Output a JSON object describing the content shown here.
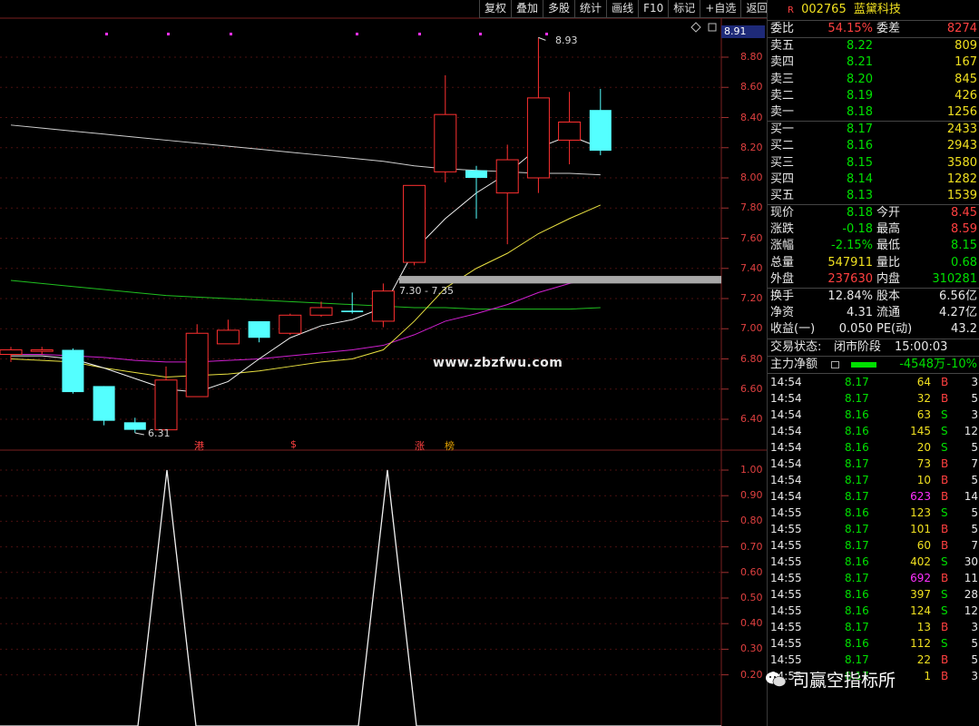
{
  "toolbar": [
    "复权",
    "叠加",
    "多股",
    "统计",
    "画线",
    "F10",
    "标记",
    "+自选",
    "返回"
  ],
  "price_tag": "8.91",
  "price_axis": [
    "8.80",
    "8.60",
    "8.40",
    "8.20",
    "8.00",
    "7.80",
    "7.60",
    "7.40",
    "7.20",
    "7.00",
    "6.80",
    "6.60",
    "6.40"
  ],
  "sub_axis": [
    "1.00",
    "0.90",
    "0.80",
    "0.70",
    "0.60",
    "0.50",
    "0.40",
    "0.30",
    "0.20"
  ],
  "annotations": {
    "high": "8.93",
    "low": "6.31",
    "range": "7.30 - 7.35"
  },
  "markers": [
    {
      "text": "港",
      "color": "#ff4040"
    },
    {
      "text": "$",
      "color": "#ff4040"
    },
    {
      "text": "涨",
      "color": "#ff4040"
    },
    {
      "text": "榜",
      "color": "#e0a000"
    }
  ],
  "watermark": "www.zbzfwu.com",
  "chart_data": {
    "type": "candlestick",
    "candles": [
      {
        "o": 6.86,
        "c": 6.83,
        "h": 6.88,
        "l": 6.78,
        "color": "red"
      },
      {
        "o": 6.86,
        "c": 6.85,
        "h": 6.88,
        "l": 6.83,
        "color": "red"
      },
      {
        "o": 6.86,
        "c": 6.58,
        "h": 6.87,
        "l": 6.57,
        "color": "cyan"
      },
      {
        "o": 6.62,
        "c": 6.39,
        "h": 6.62,
        "l": 6.36,
        "color": "cyan"
      },
      {
        "o": 6.38,
        "c": 6.33,
        "h": 6.41,
        "l": 6.31,
        "color": "cyan"
      },
      {
        "o": 6.33,
        "c": 6.66,
        "h": 6.75,
        "l": 6.33,
        "color": "red"
      },
      {
        "o": 6.55,
        "c": 6.97,
        "h": 7.03,
        "l": 6.55,
        "color": "red"
      },
      {
        "o": 6.9,
        "c": 6.99,
        "h": 7.06,
        "l": 6.9,
        "color": "red"
      },
      {
        "o": 7.05,
        "c": 6.94,
        "h": 7.05,
        "l": 6.91,
        "color": "cyan"
      },
      {
        "o": 6.97,
        "c": 7.09,
        "h": 7.1,
        "l": 6.96,
        "color": "red"
      },
      {
        "o": 7.09,
        "c": 7.14,
        "h": 7.18,
        "l": 7.08,
        "color": "red"
      },
      {
        "o": 7.12,
        "c": 7.11,
        "h": 7.24,
        "l": 7.1,
        "color": "cyan"
      },
      {
        "o": 7.05,
        "c": 7.25,
        "h": 7.3,
        "l": 7.01,
        "color": "red"
      },
      {
        "o": 7.44,
        "c": 7.95,
        "h": 7.95,
        "l": 7.42,
        "color": "red"
      },
      {
        "o": 8.04,
        "c": 8.42,
        "h": 8.68,
        "l": 7.97,
        "color": "red"
      },
      {
        "o": 8.05,
        "c": 8.0,
        "h": 8.08,
        "l": 7.73,
        "color": "cyan"
      },
      {
        "o": 7.9,
        "c": 8.12,
        "h": 8.22,
        "l": 7.56,
        "color": "red"
      },
      {
        "o": 8.0,
        "c": 8.53,
        "h": 8.93,
        "l": 7.9,
        "color": "red"
      },
      {
        "o": 8.25,
        "c": 8.37,
        "h": 8.57,
        "l": 8.09,
        "color": "red"
      },
      {
        "o": 8.45,
        "c": 8.18,
        "h": 8.59,
        "l": 8.15,
        "color": "cyan"
      }
    ],
    "ma_white": [
      6.82,
      6.82,
      6.8,
      6.74,
      6.67,
      6.6,
      6.58,
      6.65,
      6.8,
      6.94,
      7.02,
      7.06,
      7.14,
      7.52,
      7.73,
      7.9,
      8.03,
      8.2,
      8.28,
      8.2
    ],
    "ma_yellow": [
      6.8,
      6.79,
      6.78,
      6.74,
      6.71,
      6.68,
      6.69,
      6.7,
      6.72,
      6.75,
      6.78,
      6.8,
      6.86,
      7.05,
      7.27,
      7.4,
      7.5,
      7.63,
      7.73,
      7.82
    ],
    "ma_magenta": [
      6.83,
      6.83,
      6.82,
      6.81,
      6.79,
      6.78,
      6.78,
      6.79,
      6.8,
      6.82,
      6.84,
      6.86,
      6.89,
      6.96,
      7.05,
      7.1,
      7.16,
      7.24,
      7.3,
      7.34
    ],
    "ma_green": [
      7.32,
      7.3,
      7.28,
      7.26,
      7.24,
      7.22,
      7.21,
      7.2,
      7.19,
      7.18,
      7.17,
      7.16,
      7.15,
      7.14,
      7.14,
      7.13,
      7.13,
      7.13,
      7.13,
      7.14
    ],
    "ma_gray": [
      8.35,
      8.33,
      8.31,
      8.29,
      8.27,
      8.25,
      8.23,
      8.21,
      8.19,
      8.17,
      8.15,
      8.13,
      8.11,
      8.08,
      8.06,
      8.05,
      8.04,
      8.03,
      8.03,
      8.02
    ],
    "price_range": [
      6.2,
      9.0
    ],
    "sub_values": [
      0,
      0,
      0,
      0,
      0,
      1,
      0,
      0,
      0,
      0,
      0,
      0,
      0,
      1,
      0,
      0,
      0,
      0,
      0,
      0
    ],
    "sub_range": [
      0,
      1.1
    ]
  },
  "stock": {
    "flag": "R",
    "code": "002765",
    "name": "蓝黛科技"
  },
  "weibi": {
    "label1": "委比",
    "v1": "54.15%",
    "label2": "委差",
    "v2": "8274"
  },
  "sell": [
    {
      "label": "卖五",
      "price": "8.22",
      "vol": "809"
    },
    {
      "label": "卖四",
      "price": "8.21",
      "vol": "167"
    },
    {
      "label": "卖三",
      "price": "8.20",
      "vol": "845"
    },
    {
      "label": "卖二",
      "price": "8.19",
      "vol": "426"
    },
    {
      "label": "卖一",
      "price": "8.18",
      "vol": "1256"
    }
  ],
  "buy": [
    {
      "label": "买一",
      "price": "8.17",
      "vol": "2433"
    },
    {
      "label": "买二",
      "price": "8.16",
      "vol": "2943"
    },
    {
      "label": "买三",
      "price": "8.15",
      "vol": "3580"
    },
    {
      "label": "买四",
      "price": "8.14",
      "vol": "1282"
    },
    {
      "label": "买五",
      "price": "8.13",
      "vol": "1539"
    }
  ],
  "quote": [
    {
      "l1": "现价",
      "v1": "8.18",
      "c1": "green",
      "l2": "今开",
      "v2": "8.45",
      "c2": "red"
    },
    {
      "l1": "涨跌",
      "v1": "-0.18",
      "c1": "green",
      "l2": "最高",
      "v2": "8.59",
      "c2": "red"
    },
    {
      "l1": "涨幅",
      "v1": "-2.15%",
      "c1": "green",
      "l2": "最低",
      "v2": "8.15",
      "c2": "green"
    },
    {
      "l1": "总量",
      "v1": "547911",
      "c1": "yellow",
      "l2": "量比",
      "v2": "0.68",
      "c2": "green"
    },
    {
      "l1": "外盘",
      "v1": "237630",
      "c1": "red",
      "l2": "内盘",
      "v2": "310281",
      "c2": "green"
    }
  ],
  "fin": [
    {
      "l1": "换手",
      "v1": "12.84%",
      "l2": "股本",
      "v2": "6.56亿"
    },
    {
      "l1": "净资",
      "v1": "4.31",
      "l2": "流通",
      "v2": "4.27亿"
    },
    {
      "l1": "收益(一)",
      "v1": "0.050",
      "l2": "PE(动)",
      "v2": "43.2"
    }
  ],
  "trade_status": {
    "label": "交易状态:",
    "status": "闭市阶段",
    "time": "15:00:03"
  },
  "main_flow": {
    "label": "主力净额",
    "value": "-4548万",
    "pct": "-10%"
  },
  "ticks": [
    {
      "t": "14:54",
      "p": "8.17",
      "v": "64",
      "vc": "yellow",
      "bs": "B",
      "n": "3"
    },
    {
      "t": "14:54",
      "p": "8.17",
      "v": "32",
      "vc": "yellow",
      "bs": "B",
      "n": "5"
    },
    {
      "t": "14:54",
      "p": "8.16",
      "v": "63",
      "vc": "yellow",
      "bs": "S",
      "n": "3"
    },
    {
      "t": "14:54",
      "p": "8.16",
      "v": "145",
      "vc": "yellow",
      "bs": "S",
      "n": "12"
    },
    {
      "t": "14:54",
      "p": "8.16",
      "v": "20",
      "vc": "yellow",
      "bs": "S",
      "n": "5"
    },
    {
      "t": "14:54",
      "p": "8.17",
      "v": "73",
      "vc": "yellow",
      "bs": "B",
      "n": "7"
    },
    {
      "t": "14:54",
      "p": "8.17",
      "v": "10",
      "vc": "yellow",
      "bs": "B",
      "n": "5"
    },
    {
      "t": "14:54",
      "p": "8.17",
      "v": "623",
      "vc": "magenta",
      "bs": "B",
      "n": "14"
    },
    {
      "t": "14:55",
      "p": "8.16",
      "v": "123",
      "vc": "yellow",
      "bs": "S",
      "n": "5"
    },
    {
      "t": "14:55",
      "p": "8.17",
      "v": "101",
      "vc": "yellow",
      "bs": "B",
      "n": "5"
    },
    {
      "t": "14:55",
      "p": "8.17",
      "v": "60",
      "vc": "yellow",
      "bs": "B",
      "n": "7"
    },
    {
      "t": "14:55",
      "p": "8.16",
      "v": "402",
      "vc": "yellow",
      "bs": "S",
      "n": "30"
    },
    {
      "t": "14:55",
      "p": "8.17",
      "v": "692",
      "vc": "magenta",
      "bs": "B",
      "n": "11"
    },
    {
      "t": "14:55",
      "p": "8.16",
      "v": "397",
      "vc": "yellow",
      "bs": "S",
      "n": "28"
    },
    {
      "t": "14:55",
      "p": "8.16",
      "v": "124",
      "vc": "yellow",
      "bs": "S",
      "n": "12"
    },
    {
      "t": "14:55",
      "p": "8.17",
      "v": "13",
      "vc": "yellow",
      "bs": "B",
      "n": "3"
    },
    {
      "t": "14:55",
      "p": "8.16",
      "v": "112",
      "vc": "yellow",
      "bs": "S",
      "n": "5"
    },
    {
      "t": "14:55",
      "p": "8.17",
      "v": "22",
      "vc": "yellow",
      "bs": "B",
      "n": "5"
    },
    {
      "t": "14:55",
      "p": "8.17",
      "v": "1",
      "vc": "yellow",
      "bs": "B",
      "n": "3"
    }
  ],
  "wechat_label": "司赢空指标所"
}
